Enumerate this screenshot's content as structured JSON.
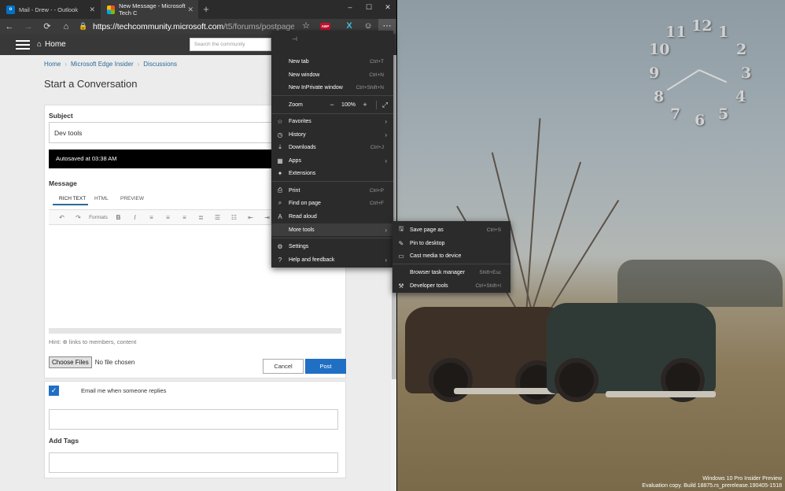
{
  "tabs": [
    {
      "label": "Mail - Drew - - Outlook",
      "icon": "outlook-icon"
    },
    {
      "label": "New Message - Microsoft Tech C",
      "icon": "microsoft-icon"
    }
  ],
  "window_controls": {
    "minimize": "–",
    "maximize": "☐",
    "close": "✕"
  },
  "address_bar": {
    "domain": "https://techcommunity.microsoft.com",
    "path": "/t5/forums/postpage/board-i..."
  },
  "extensions": {
    "abp_label": "ABP"
  },
  "site": {
    "home_label": "Home",
    "search_placeholder": "Search the community"
  },
  "breadcrumb": [
    "Home",
    "Microsoft Edge Insider",
    "Discussions"
  ],
  "page_title": "Start a Conversation",
  "form": {
    "subject_label": "Subject",
    "subject_value": "Dev tools",
    "autosave_text": "Autosaved at 03:38 AM",
    "message_label": "Message",
    "editor_tabs": [
      "RICH TEXT",
      "HTML",
      "PREVIEW"
    ],
    "formats_label": "Formats",
    "hint_text": "Hint:  ⊕ links to members, content",
    "choose_files_label": "Choose Files",
    "no_file_text": "No file chosen",
    "cancel_label": "Cancel",
    "post_label": "Post",
    "email_me_label": "Email me when someone replies",
    "email_me_checked": true,
    "tags_label": "Add Tags"
  },
  "main_menu": {
    "new_tab": {
      "label": "New tab",
      "shortcut": "Ctrl+T"
    },
    "new_window": {
      "label": "New window",
      "shortcut": "Ctrl+N"
    },
    "new_private": {
      "label": "New InPrivate window",
      "shortcut": "Ctrl+Shift+N"
    },
    "zoom": {
      "label": "Zoom",
      "value": "100%"
    },
    "favorites": {
      "label": "Favorites"
    },
    "history": {
      "label": "History"
    },
    "downloads": {
      "label": "Downloads",
      "shortcut": "Ctrl+J"
    },
    "apps": {
      "label": "Apps"
    },
    "extensions": {
      "label": "Extensions"
    },
    "print": {
      "label": "Print",
      "shortcut": "Ctrl+P"
    },
    "find": {
      "label": "Find on page",
      "shortcut": "Ctrl+F"
    },
    "read_aloud": {
      "label": "Read aloud"
    },
    "more_tools": {
      "label": "More tools"
    },
    "settings": {
      "label": "Settings"
    },
    "help": {
      "label": "Help and feedback"
    }
  },
  "more_tools_menu": {
    "save_page": {
      "label": "Save page as",
      "shortcut": "Ctrl+S"
    },
    "pin": {
      "label": "Pin to desktop"
    },
    "cast": {
      "label": "Cast media to device"
    },
    "task_manager": {
      "label": "Browser task manager",
      "shortcut": "Shift+Esc"
    },
    "dev_tools": {
      "label": "Developer tools",
      "shortcut": "Ctrl+Shift+I"
    }
  },
  "clock_numbers": [
    "12",
    "1",
    "2",
    "3",
    "4",
    "5",
    "6",
    "7",
    "8",
    "9",
    "10",
    "11"
  ],
  "watermark": {
    "line1": "Windows 10 Pro Insider Preview",
    "line2": "Evaluation copy. Build 18875.rs_prerelease.190405-1518"
  }
}
